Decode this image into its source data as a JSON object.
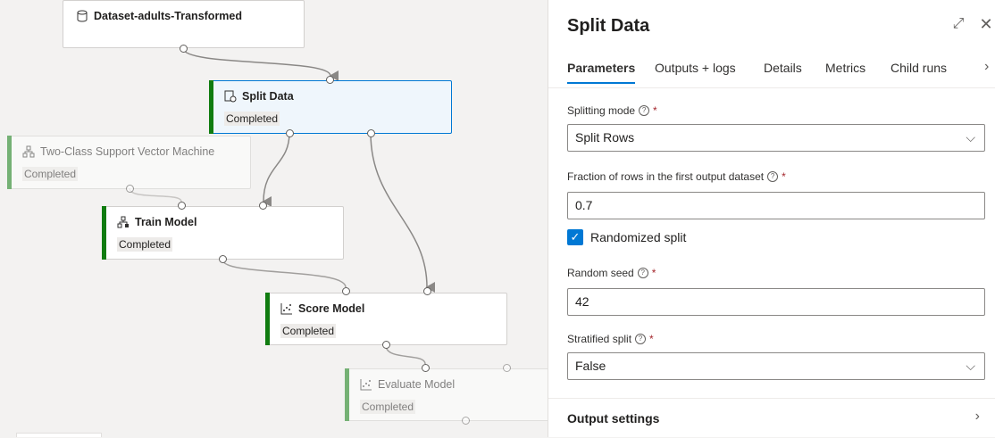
{
  "canvas": {
    "nodes": [
      {
        "title": "Dataset-adults-Transformed",
        "status": ""
      },
      {
        "title": "Split Data",
        "status": "Completed"
      },
      {
        "title": "Two-Class Support Vector Machine",
        "status": "Completed"
      },
      {
        "title": "Train Model",
        "status": "Completed"
      },
      {
        "title": "Score Model",
        "status": "Completed"
      },
      {
        "title": "Evaluate Model",
        "status": "Completed"
      }
    ]
  },
  "panel": {
    "title": "Split Data",
    "tabs": [
      "Parameters",
      "Outputs + logs",
      "Details",
      "Metrics",
      "Child runs"
    ],
    "splitting_mode": {
      "label": "Splitting mode",
      "value": "Split Rows"
    },
    "fraction": {
      "label": "Fraction of rows in the first output dataset",
      "value": "0.7"
    },
    "randomized": {
      "label": "Randomized split",
      "checked": true
    },
    "seed": {
      "label": "Random seed",
      "value": "42"
    },
    "stratified": {
      "label": "Stratified split",
      "value": "False"
    },
    "output_settings": "Output settings",
    "required_mark": "*"
  }
}
